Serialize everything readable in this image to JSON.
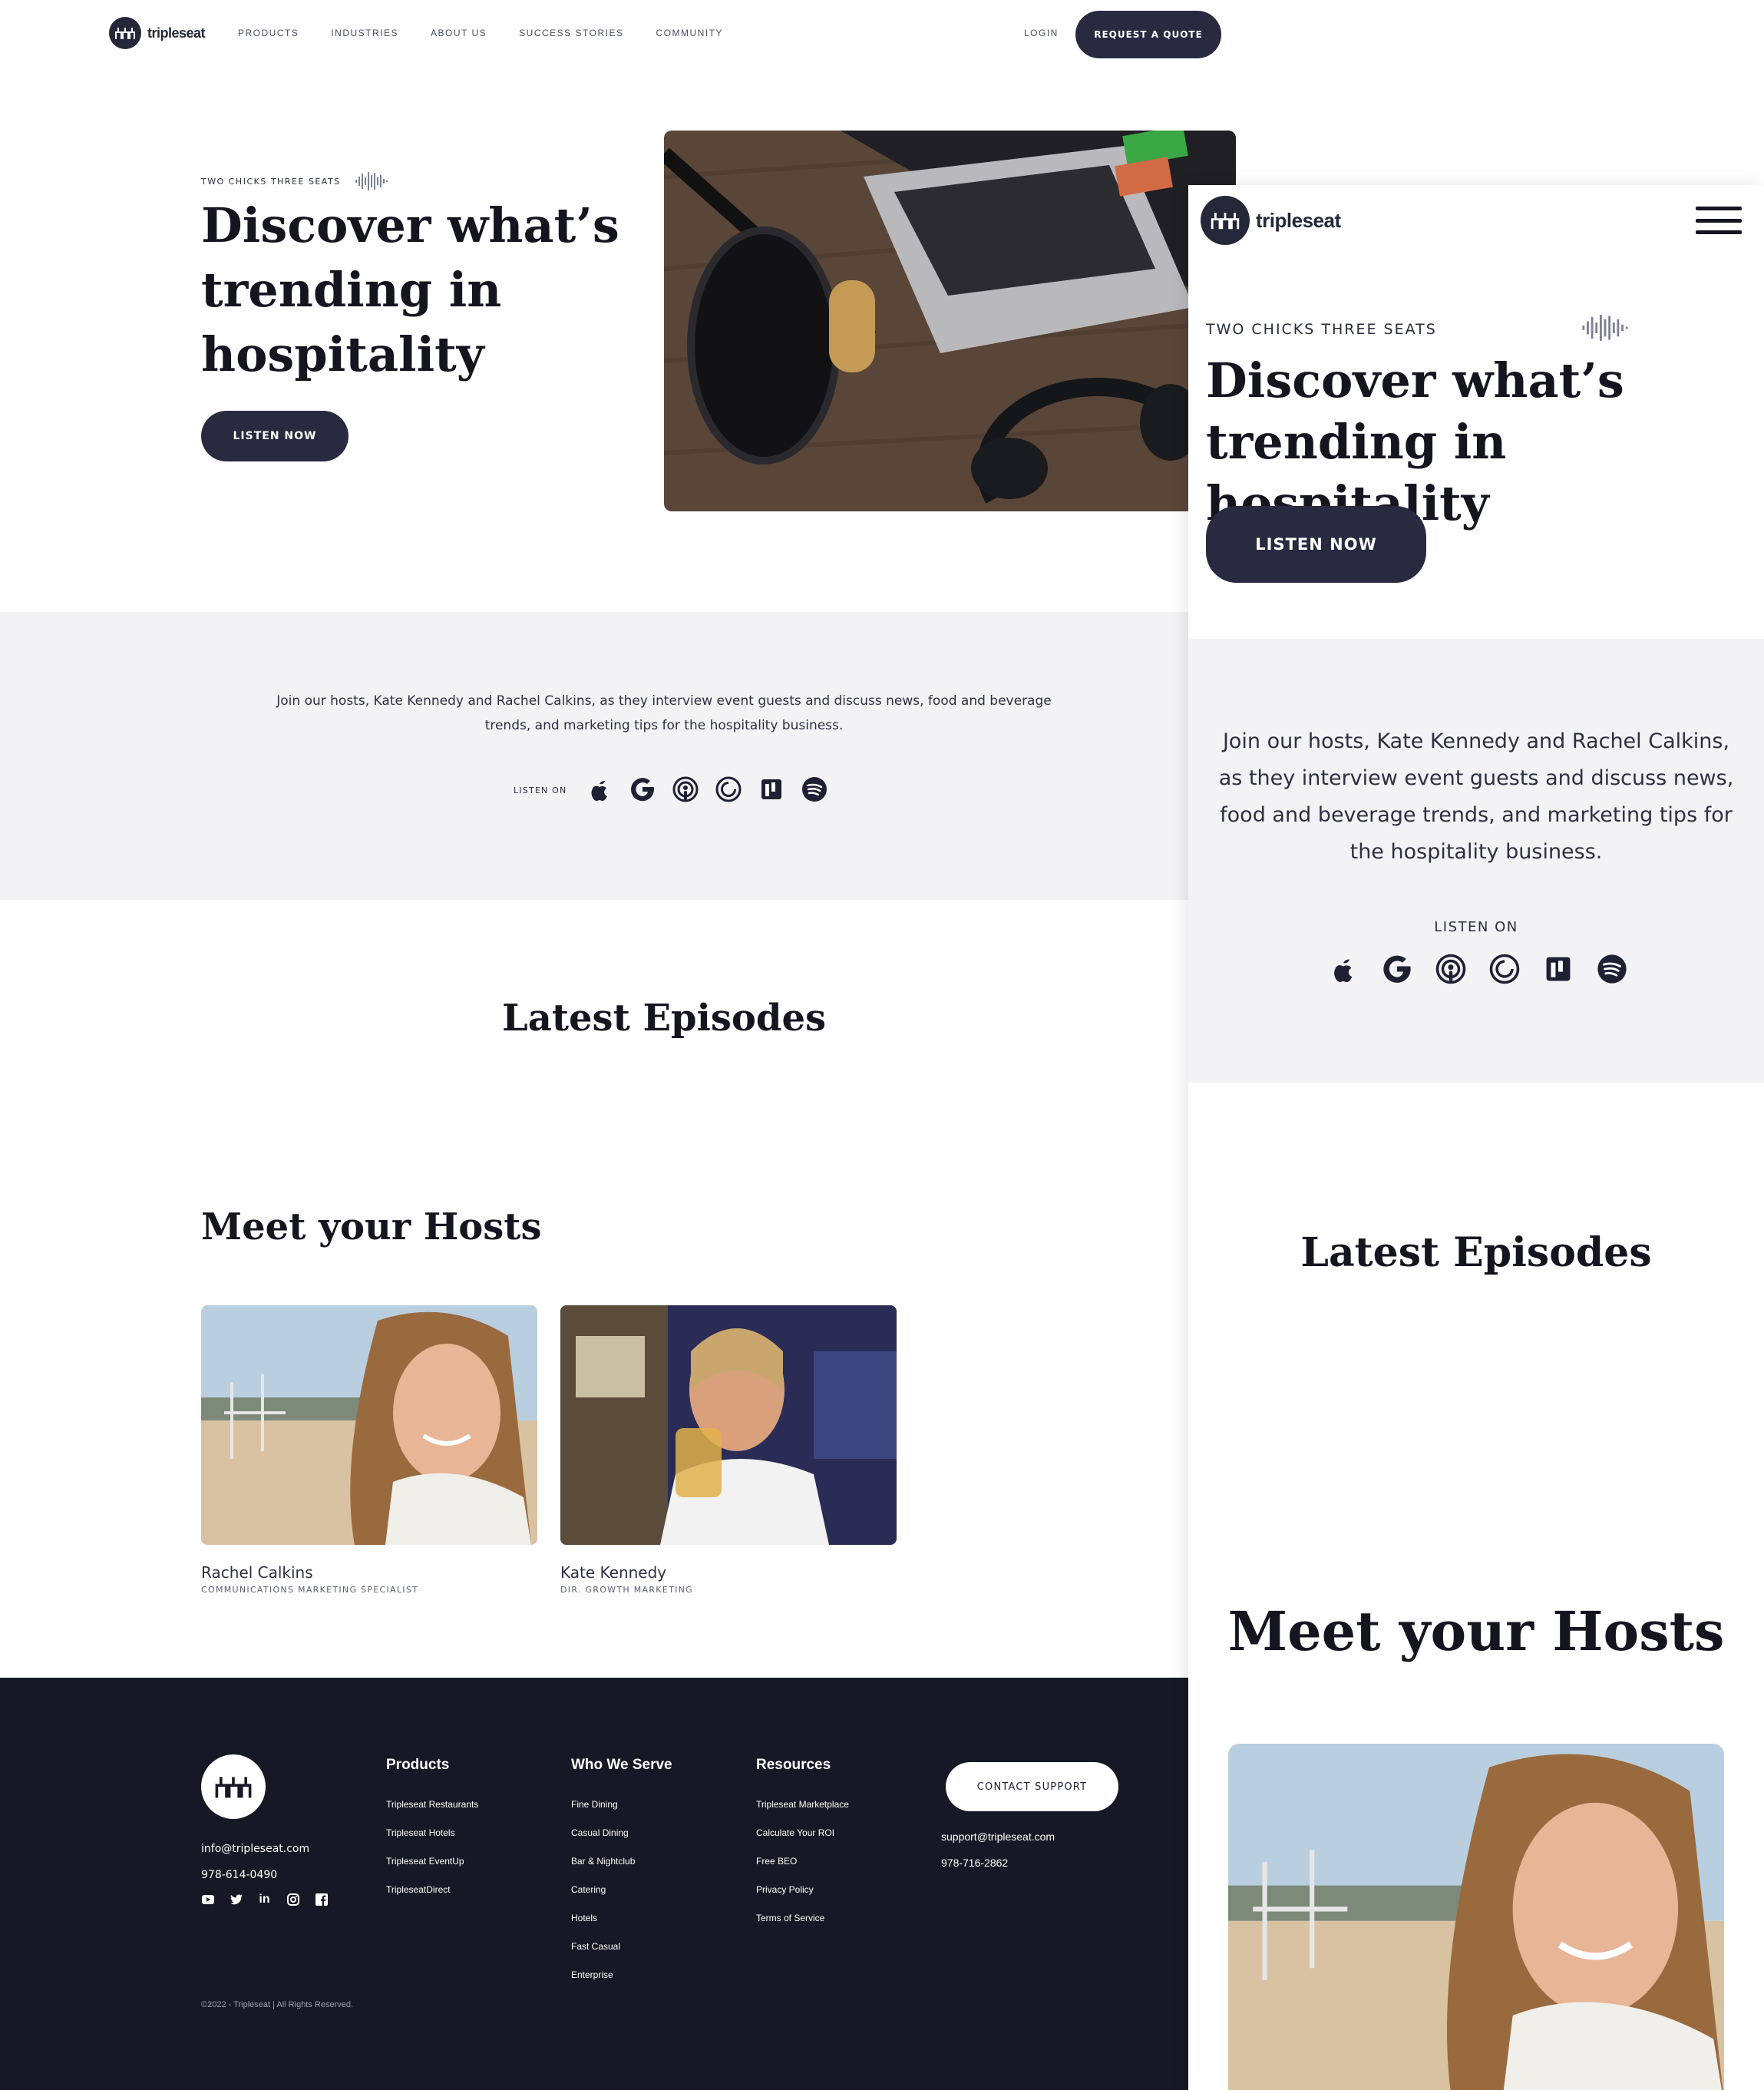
{
  "brand": {
    "name": "tripleseat",
    "dark": "#282b40",
    "footer_bg": "#171825",
    "gray_bg": "#f3f3f6"
  },
  "nav": {
    "items": [
      "PRODUCTS",
      "INDUSTRIES",
      "ABOUT US",
      "SUCCESS STORIES",
      "COMMUNITY"
    ],
    "login": "LOGIN",
    "cta": "REQUEST A QUOTE"
  },
  "hero": {
    "eyebrow": "TWO CHICKS THREE SEATS",
    "title": "Discover what’s trending in hospitality",
    "button": "LISTEN NOW"
  },
  "intro": {
    "text": "Join our hosts, Kate Kennedy and Rachel Calkins, as they interview event guests and discuss news, food and beverage trends, and marketing tips for the hospitality business.",
    "listen_on": "LISTEN ON",
    "platform_icons": [
      "apple-podcasts-icon",
      "google-podcasts-icon",
      "podcast-antenna-icon",
      "pocket-casts-icon",
      "stitcher-icon",
      "spotify-icon"
    ]
  },
  "episodes": {
    "title": "Latest Episodes"
  },
  "hosts": {
    "title": "Meet your Hosts",
    "people": [
      {
        "name": "Rachel Calkins",
        "role": "COMMUNICATIONS MARKETING SPECIALIST"
      },
      {
        "name": "Kate Kennedy",
        "role": "DIR. GROWTH MARKETING"
      }
    ]
  },
  "footer": {
    "email": "info@tripleseat.com",
    "phone": "978-614-0490",
    "social_icons": [
      "youtube-icon",
      "twitter-icon",
      "linkedin-icon",
      "instagram-icon",
      "facebook-icon"
    ],
    "columns": [
      {
        "title": "Products",
        "links": [
          "Tripleseat Restaurants",
          "Tripleseat Hotels",
          "Tripleseat EventUp",
          "TripleseatDirect"
        ]
      },
      {
        "title": "Who We Serve",
        "links": [
          "Fine Dining",
          "Casual Dining",
          "Bar & Nightclub",
          "Catering",
          "Hotels",
          "Fast Casual",
          "Enterprise"
        ]
      },
      {
        "title": "Resources",
        "links": [
          "Tripleseat Marketplace",
          "Calculate Your ROI",
          "Free BEO",
          "Privacy Policy",
          "Terms of Service"
        ]
      }
    ],
    "support_button": "CONTACT SUPPORT",
    "support_email": "support@tripleseat.com",
    "support_phone": "978-716-2862",
    "copyright": "©2022 - Tripleseat | All Rights Reserved."
  }
}
